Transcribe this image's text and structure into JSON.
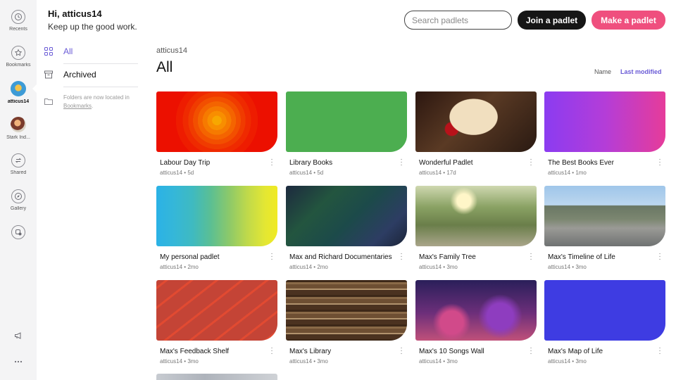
{
  "rail": {
    "items": [
      {
        "label": "Recents",
        "icon": "clock-icon"
      },
      {
        "label": "Bookmarks",
        "icon": "star-icon"
      },
      {
        "label": "atticus14",
        "icon": "avatar"
      },
      {
        "label": "Stark Ind...",
        "icon": "avatar"
      },
      {
        "label": "Shared",
        "icon": "shared-icon"
      },
      {
        "label": "Gallery",
        "icon": "compass-icon"
      },
      {
        "label": "",
        "icon": "add-icon"
      }
    ],
    "bottom_icons": [
      "megaphone-icon",
      "more-icon"
    ]
  },
  "header": {
    "greeting": "Hi, atticus14",
    "subtitle": "Keep up the good work.",
    "search_placeholder": "Search padlets",
    "join_label": "Join a padlet",
    "make_label": "Make a padlet"
  },
  "folders": {
    "all_label": "All",
    "archived_label": "Archived",
    "note_text": "Folders are now located in",
    "note_link": "Bookmarks",
    "note_end": "."
  },
  "main": {
    "owner": "atticus14",
    "title": "All",
    "sort_name": "Name",
    "sort_last_modified": "Last modified"
  },
  "padlets": [
    {
      "title": "Labour Day Trip",
      "author": "atticus14",
      "age": "5d",
      "thumb": "orange-rings"
    },
    {
      "title": "Library Books",
      "author": "atticus14",
      "age": "5d",
      "thumb": "green"
    },
    {
      "title": "Wonderful Padlet",
      "author": "atticus14",
      "age": "17d",
      "thumb": "puppy-photo"
    },
    {
      "title": "The Best Books Ever",
      "author": "atticus14",
      "age": "1mo",
      "thumb": "purple-gradient"
    },
    {
      "title": "My personal padlet",
      "author": "atticus14",
      "age": "2mo",
      "thumb": "rainbow-stripes"
    },
    {
      "title": "Max and Richard Documentaries",
      "author": "atticus14",
      "age": "2mo",
      "thumb": "low-poly"
    },
    {
      "title": "Max's Family Tree",
      "author": "atticus14",
      "age": "3mo",
      "thumb": "tree-photo"
    },
    {
      "title": "Max's Timeline of Life",
      "author": "atticus14",
      "age": "3mo",
      "thumb": "street-photo"
    },
    {
      "title": "Max's Feedback Shelf",
      "author": "atticus14",
      "age": "3mo",
      "thumb": "pencils"
    },
    {
      "title": "Max's Library",
      "author": "atticus14",
      "age": "3mo",
      "thumb": "bookshelf-photo"
    },
    {
      "title": "Max's 10 Songs Wall",
      "author": "atticus14",
      "age": "3mo",
      "thumb": "dancers-photo"
    },
    {
      "title": "Max's Map of Life",
      "author": "atticus14",
      "age": "3mo",
      "thumb": "blue"
    }
  ],
  "meta_separator": "•",
  "colors": {
    "accent": "#6a5bd6",
    "make_button": "#ef4f7e",
    "join_button": "#161616",
    "rail_background": "#f4f4f5"
  }
}
